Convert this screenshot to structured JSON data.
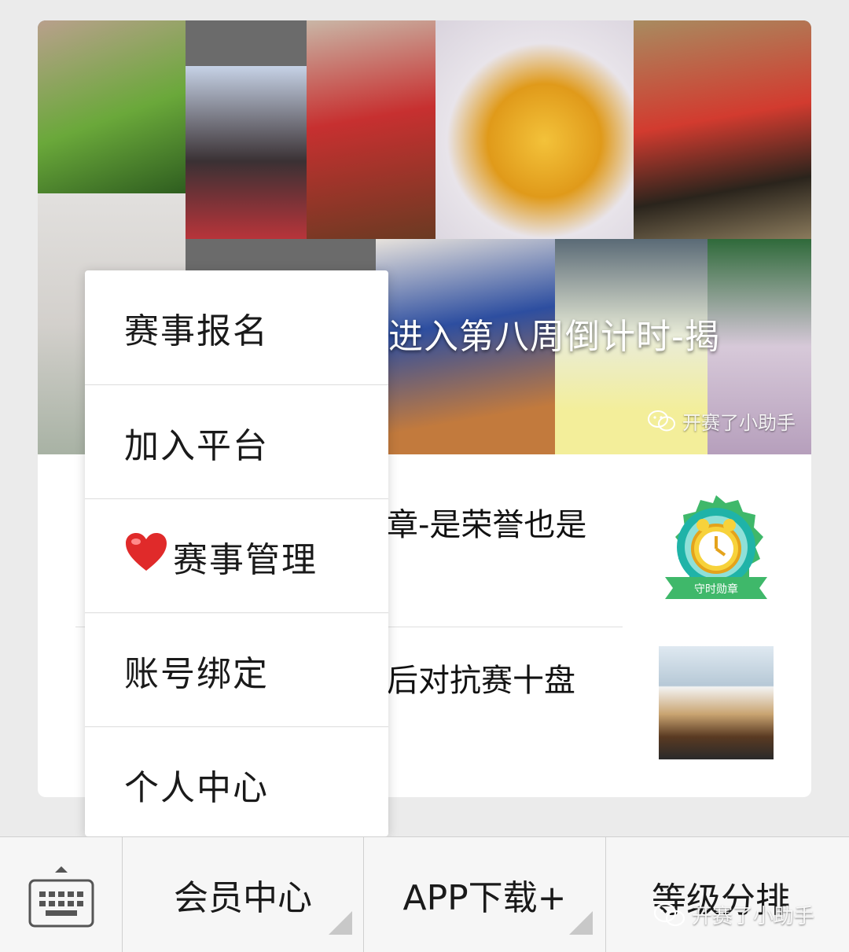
{
  "article_card": {
    "hero_title_line1": "进入第八周倒计时-揭",
    "hero_title_line2": "",
    "hero_watermark": "开赛了小助手",
    "articles": [
      {
        "line1": "章-是荣誉也是",
        "badge_text": "守时勋章"
      },
      {
        "line1": "后对抗赛十盘"
      }
    ]
  },
  "popup_menu": {
    "items": [
      {
        "label": "赛事报名"
      },
      {
        "label": "加入平台"
      },
      {
        "label": "赛事管理",
        "emoji": "❤️"
      },
      {
        "label": "账号绑定"
      },
      {
        "label": "个人中心"
      }
    ]
  },
  "bottom_bar": {
    "keyboard_icon": "keyboard-icon",
    "tabs": [
      {
        "label": "会员中心"
      },
      {
        "label": "APP下载+"
      },
      {
        "label": "等级分排"
      }
    ],
    "watermark": "开赛了小助手"
  },
  "colors": {
    "background": "#ebebeb",
    "card": "#ffffff",
    "badge_green": "#3fb86a",
    "badge_teal": "#1fb3a8"
  }
}
